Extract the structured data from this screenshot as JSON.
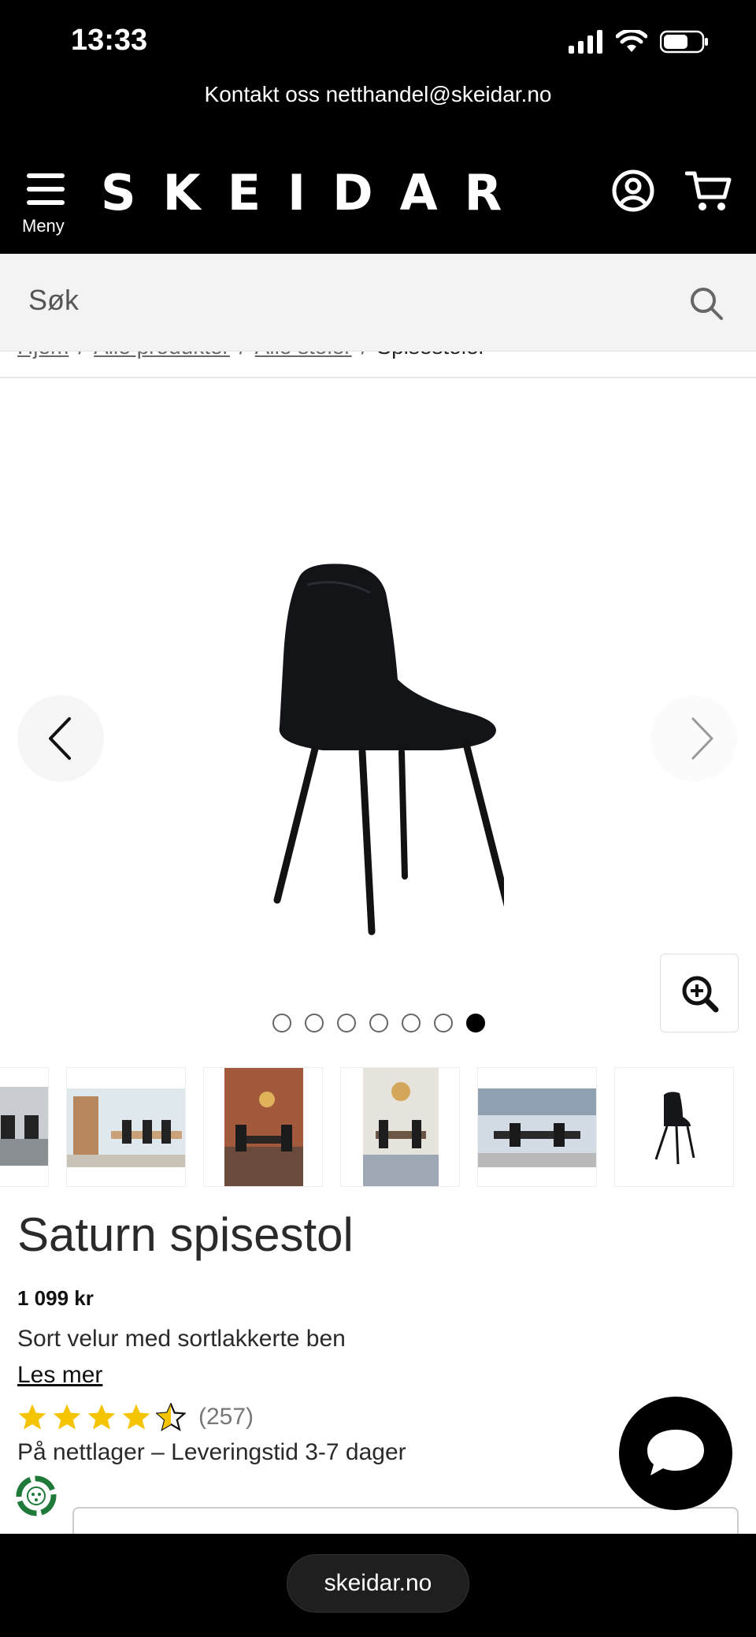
{
  "status_bar": {
    "time": "13:33"
  },
  "header": {
    "contact_text": "Kontakt oss netthandel@skeidar.no",
    "menu_label": "Meny",
    "logo": "SKEIDAR"
  },
  "search": {
    "placeholder": "Søk"
  },
  "breadcrumb": {
    "items": [
      "Hjem",
      "Alle produkter",
      "Alle stoler"
    ],
    "current": "Spisestoler",
    "separator": "/"
  },
  "gallery": {
    "slide_count": 7,
    "active_slide": 7
  },
  "product": {
    "title": "Saturn spisestol",
    "price": "1 099 kr",
    "description": "Sort velur med sortlakkerte ben",
    "read_more": "Les mer",
    "rating": 4.5,
    "rating_max": 5,
    "review_count": "(257)",
    "stock_text": "På nettlager – Leveringstid 3-7 dager"
  },
  "browser": {
    "url": "skeidar.no"
  },
  "colors": {
    "header_bg": "#000000",
    "star": "#f5c400",
    "search_bg": "#f3f3f3"
  }
}
